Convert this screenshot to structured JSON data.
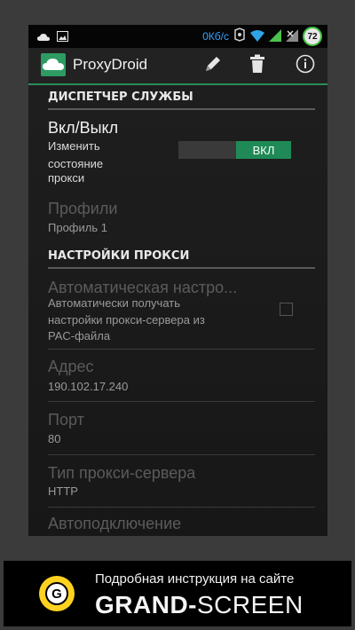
{
  "status_bar": {
    "net_speed": "0Кб/с",
    "battery": "72",
    "icons": [
      "cloud-icon",
      "image-icon",
      "sync-icon",
      "wifi-icon",
      "signal-icon",
      "no-signal-icon"
    ]
  },
  "app_bar": {
    "title": "ProxyDroid",
    "actions": [
      "edit-icon",
      "delete-icon",
      "info-icon"
    ]
  },
  "sections": {
    "service": "ДИСПЕТЧЕР СЛУЖБЫ",
    "proxy": "НАСТРОЙКИ ПРОКСИ"
  },
  "toggle_pref": {
    "title": "Вкл/Выкл",
    "summary": [
      "Изменить",
      "состояние",
      "прокси"
    ],
    "state_label": "ВКЛ",
    "enabled": true
  },
  "prefs": {
    "profiles": {
      "title": "Профили",
      "summary": "Профиль 1"
    },
    "auto": {
      "title": "Автоматическая настро...",
      "summary": [
        "Автоматически получать",
        "настройки прокси-сервера из",
        "PAC-файла"
      ],
      "checked": false
    },
    "address": {
      "title": "Адрес",
      "summary": "190.102.17.240"
    },
    "port": {
      "title": "Порт",
      "summary": "80"
    },
    "proxy_type": {
      "title": "Тип прокси-сервера",
      "summary": "HTTP"
    },
    "autoconnect": {
      "title": "Автоподключение"
    }
  },
  "footer": {
    "line1": "Подробная инструкция на сайте",
    "brand_bold": "GRAND-",
    "brand_rest": "SCREEN",
    "logo_letter": "G"
  },
  "colors": {
    "accent": "#1f8a57",
    "speed": "#33a3ff",
    "logo": "#ffd21f"
  }
}
